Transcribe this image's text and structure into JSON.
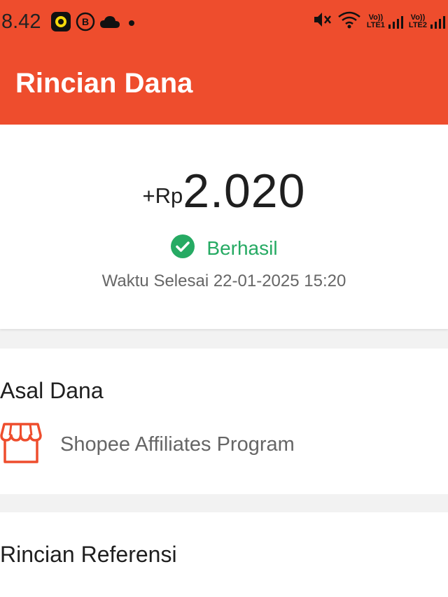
{
  "status_bar": {
    "time": "8.42",
    "left_icons": [
      "app-notification-icon",
      "b-badge-icon",
      "cloud-icon",
      "dot-icon"
    ],
    "right_icons": [
      "mute-icon",
      "wifi-icon",
      "lte1-signal-icon",
      "lte2-signal-icon"
    ],
    "lte1_label": "LTE1",
    "lte2_label": "LTE2",
    "volte_label": "Vo))"
  },
  "app_bar": {
    "title": "Rincian Dana"
  },
  "summary": {
    "amount_prefix": "+Rp",
    "amount_value": "2.020",
    "status": "Berhasil",
    "status_color": "#26aa63",
    "completion_time": "Waktu Selesai 22-01-2025 15:20"
  },
  "source": {
    "title": "Asal Dana",
    "icon": "shop-icon",
    "name": "Shopee Affiliates Program"
  },
  "reference": {
    "title": "Rincian Referensi"
  },
  "colors": {
    "brand": "#ee4d2d",
    "success": "#26aa63"
  }
}
